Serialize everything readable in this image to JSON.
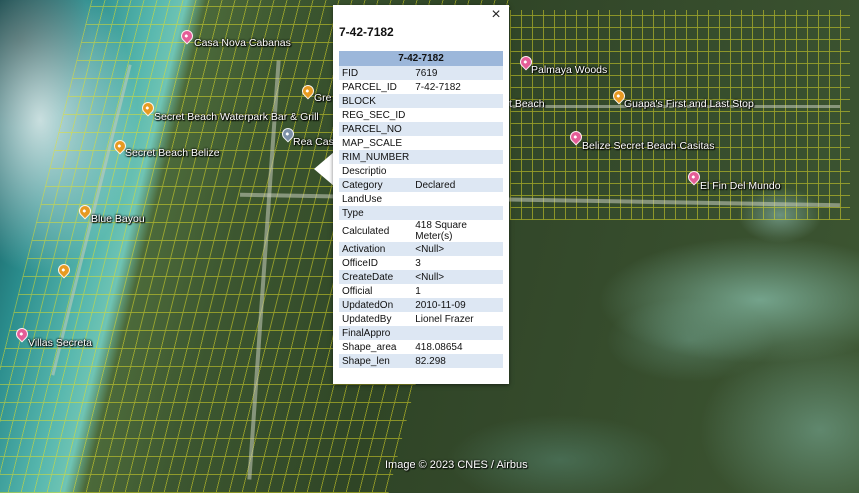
{
  "map": {
    "attribution": "Image © 2023 CNES / Airbus",
    "placemarks": [
      {
        "label": "Casa Nova Cabanas",
        "color": "pink"
      },
      {
        "label": "Secret Beach Waterpark Bar & Grill",
        "color": "orange"
      },
      {
        "label": "Secret Beach Belize",
        "color": "orange"
      },
      {
        "label": "Blue Bayou",
        "color": "orange"
      },
      {
        "label": "",
        "color": "orange"
      },
      {
        "label": "Villas Secreta",
        "color": "pink"
      },
      {
        "label": "Gre",
        "color": "orange"
      },
      {
        "label": "Rea Cas",
        "color": "gray"
      },
      {
        "label": "Palmaya Woods",
        "color": "pink"
      },
      {
        "label": "t Beach",
        "color": "none"
      },
      {
        "label": "Guapa's First and Last Stop",
        "color": "orange"
      },
      {
        "label": "Belize Secret Beach Casitas",
        "color": "pink"
      },
      {
        "label": "El Fin Del Mundo",
        "color": "pink"
      }
    ],
    "colors": {
      "parcel_line": "#e6e128",
      "pin_pink": "#e45d97",
      "pin_orange": "#e79a22",
      "header": "#9cb7da",
      "row_alt": "#dde7f3"
    }
  },
  "balloon": {
    "title": "7-42-7182",
    "table_header": "7-42-7182",
    "close_icon": "×",
    "rows": [
      {
        "key": "FID",
        "value": "7619"
      },
      {
        "key": "PARCEL_ID",
        "value": "7-42-7182"
      },
      {
        "key": "BLOCK",
        "value": ""
      },
      {
        "key": "REG_SEC_ID",
        "value": ""
      },
      {
        "key": "PARCEL_NO",
        "value": ""
      },
      {
        "key": "MAP_SCALE",
        "value": ""
      },
      {
        "key": "RIM_NUMBER",
        "value": ""
      },
      {
        "key": "Descriptio",
        "value": ""
      },
      {
        "key": "Category",
        "value": "Declared"
      },
      {
        "key": "LandUse",
        "value": ""
      },
      {
        "key": "Type",
        "value": ""
      },
      {
        "key": "Calculated",
        "value": "418 Square Meter(s)"
      },
      {
        "key": "Activation",
        "value": "<Null>"
      },
      {
        "key": "OfficeID",
        "value": "3"
      },
      {
        "key": "CreateDate",
        "value": "<Null>"
      },
      {
        "key": "Official",
        "value": "1"
      },
      {
        "key": "UpdatedOn",
        "value": "2010-11-09"
      },
      {
        "key": "UpdatedBy",
        "value": "Lionel Frazer"
      },
      {
        "key": "FinalAppro",
        "value": ""
      },
      {
        "key": "Shape_area",
        "value": "418.08654"
      },
      {
        "key": "Shape_len",
        "value": "82.298"
      }
    ]
  }
}
